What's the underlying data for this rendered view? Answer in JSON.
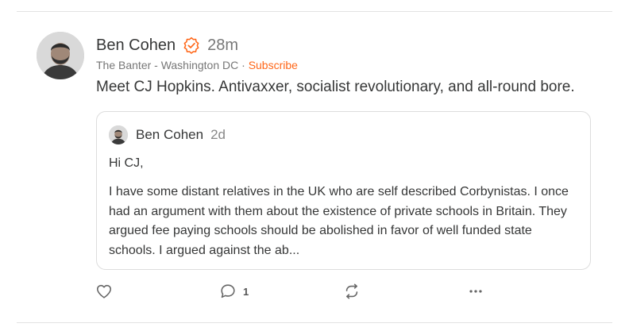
{
  "post": {
    "author": "Ben Cohen",
    "time": "28m",
    "publication": "The Banter - Washington DC",
    "separator": "·",
    "subscribe_label": "Subscribe",
    "text": "Meet CJ Hopkins. Antivaxxer, socialist revolutionary, and all-round bore."
  },
  "quote": {
    "author": "Ben Cohen",
    "time": "2d",
    "greeting": "Hi CJ,",
    "excerpt": "I have some distant relatives in the UK who are self described Corbynistas. I once had an argument with them about the existence of private schools in Britain. They argued fee paying schools should be abolished in favor of well funded state schools. I argued against the ab..."
  },
  "actions": {
    "like_icon": "heart-icon",
    "comment_icon": "comment-icon",
    "comment_count": "1",
    "restack_icon": "restack-icon",
    "more_icon": "more-icon"
  },
  "colors": {
    "accent": "#ff6719",
    "text": "#363737",
    "muted": "#777777",
    "border": "#dddddd"
  }
}
